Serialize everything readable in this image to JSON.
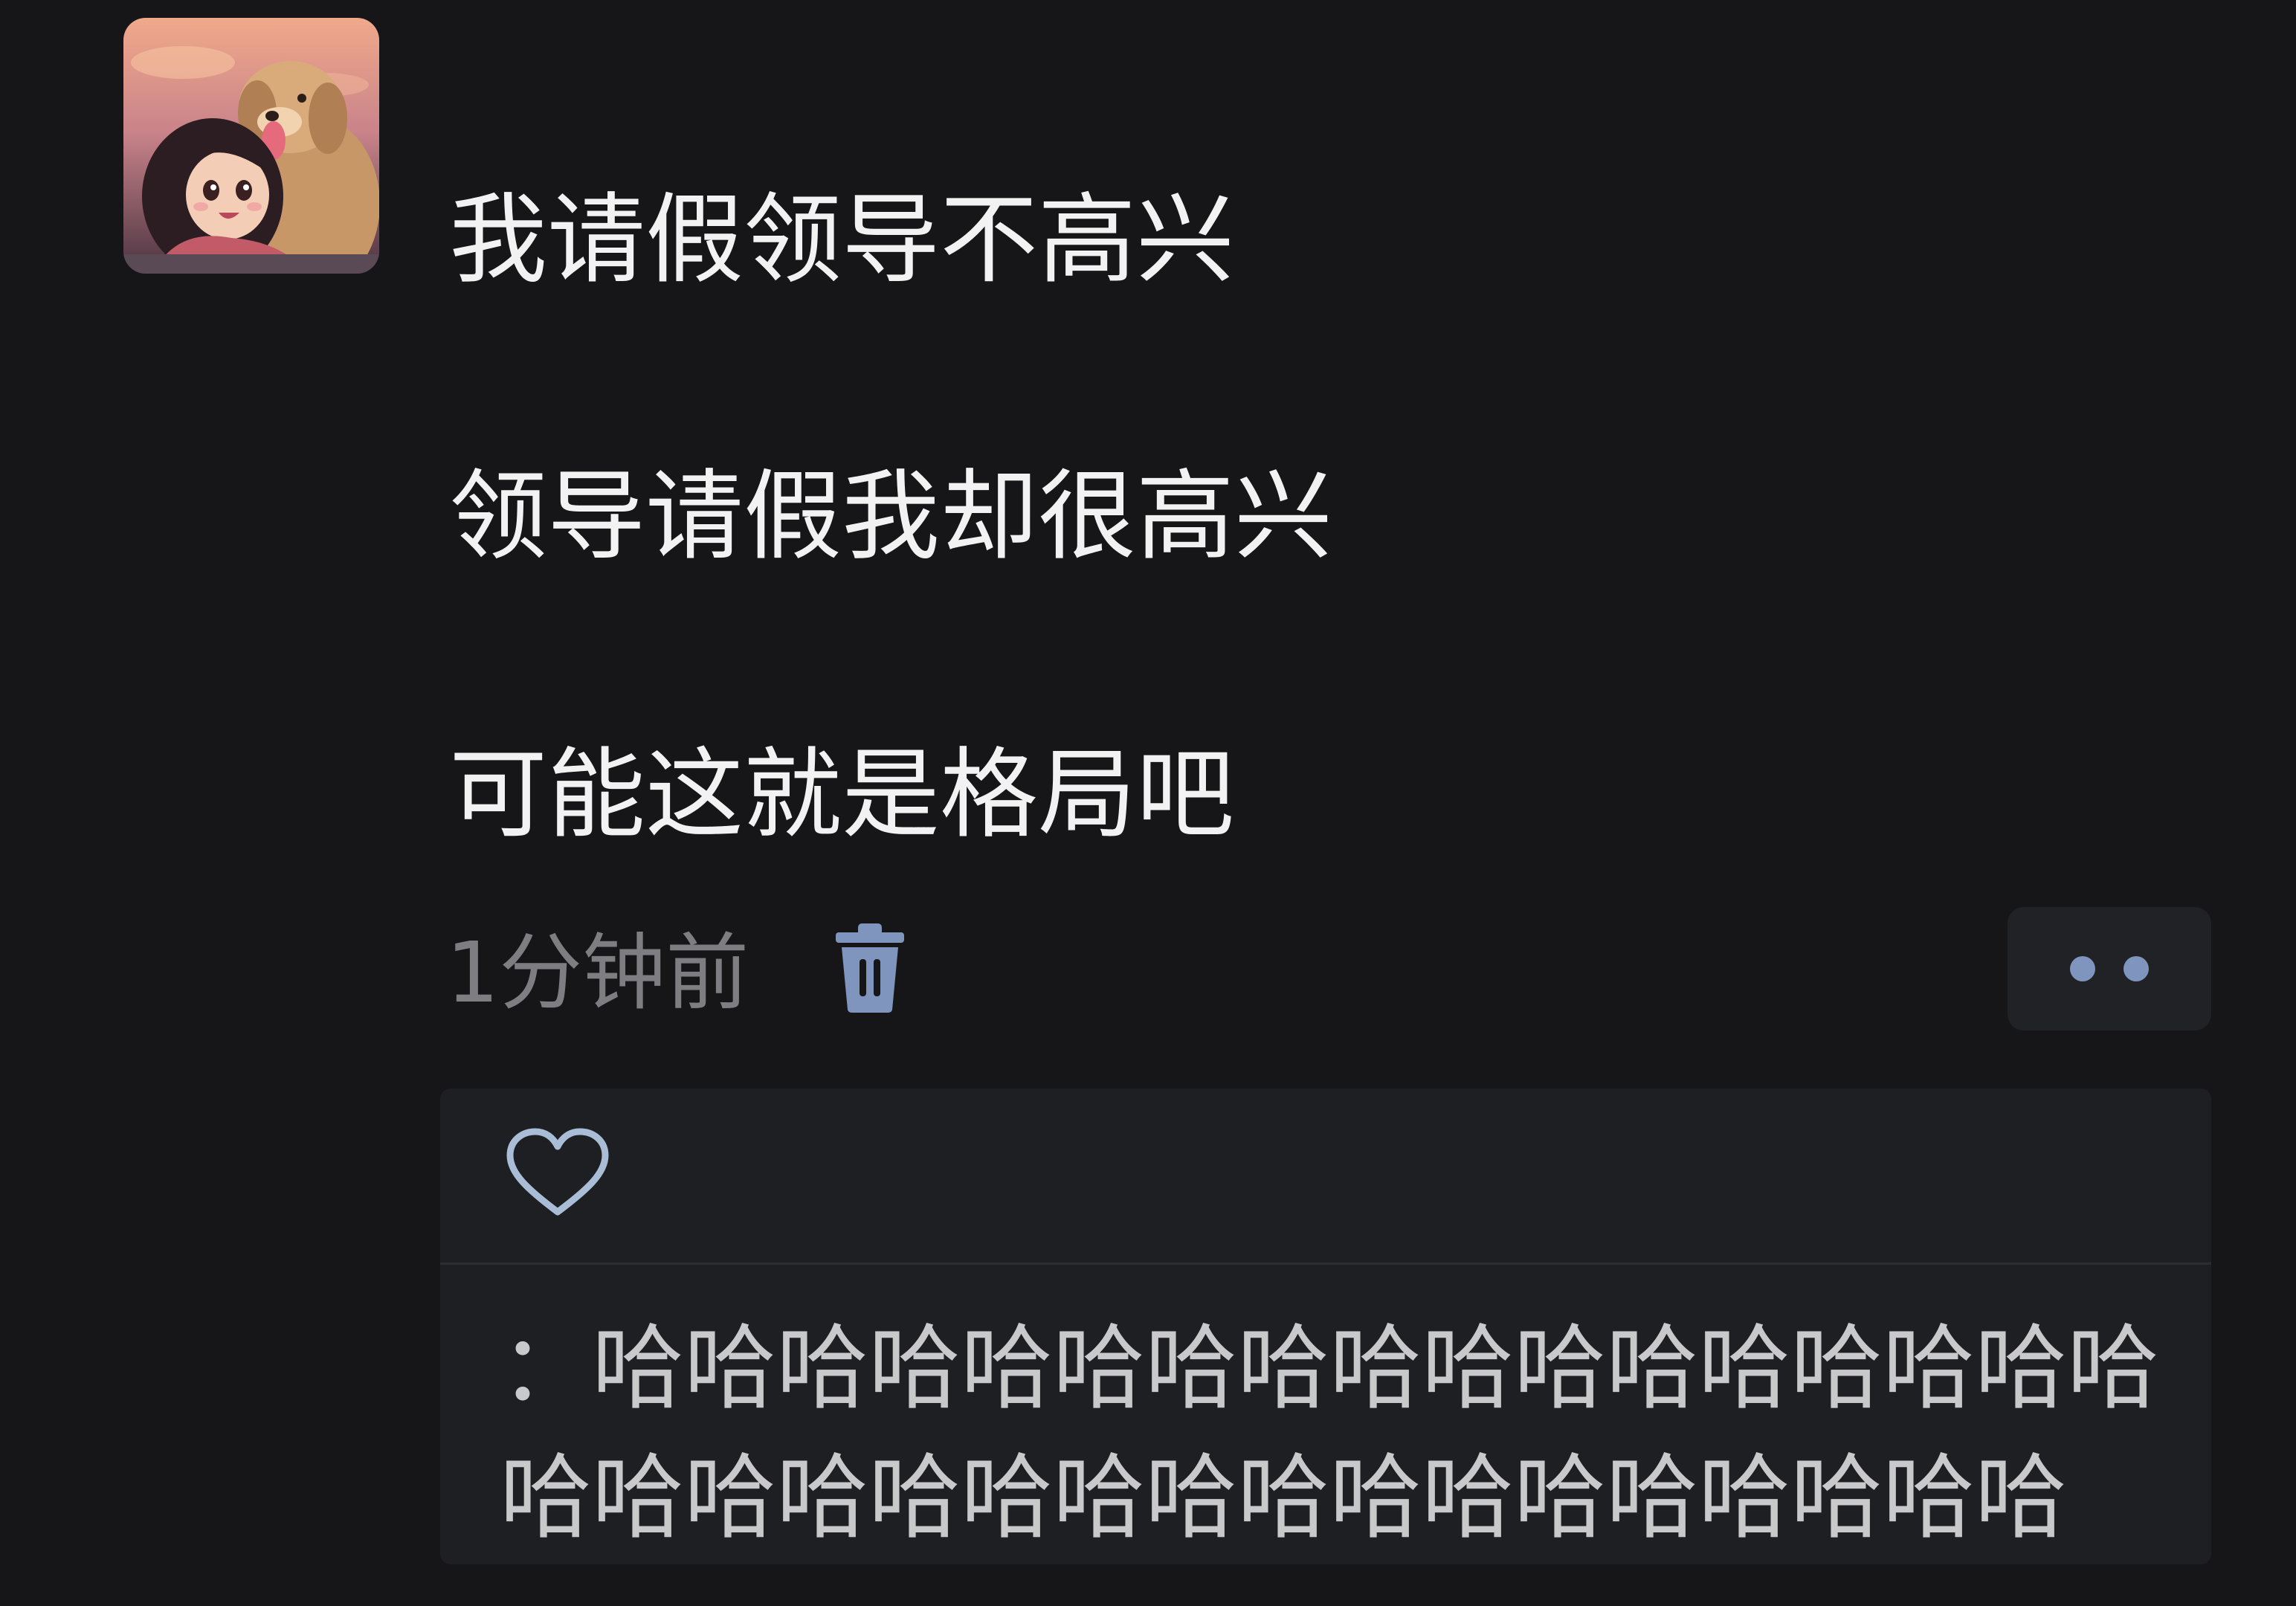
{
  "post": {
    "avatar_icon": "avatar-girl-with-dog",
    "lines": [
      "我请假领导不高兴",
      "领导请假我却很高兴",
      "可能这就是格局吧"
    ],
    "timestamp": "1分钟前",
    "delete_icon": "trash-icon",
    "more_icon": "more-dots-icon"
  },
  "interactions": {
    "like_icon": "heart-outline-icon",
    "comments": [
      {
        "author": "",
        "separator": "：",
        "text": "哈哈哈哈哈哈哈哈哈哈哈哈哈哈哈哈哈哈哈哈哈哈哈哈哈哈哈哈哈哈哈哈哈哈"
      }
    ]
  },
  "colors": {
    "background": "#161618",
    "post_text": "#f2f2f2",
    "timestamp_text": "#7d7d82",
    "accent_blue": "#7f95be",
    "panel_background": "#1e1f22",
    "comment_text": "#c9c9cc"
  }
}
